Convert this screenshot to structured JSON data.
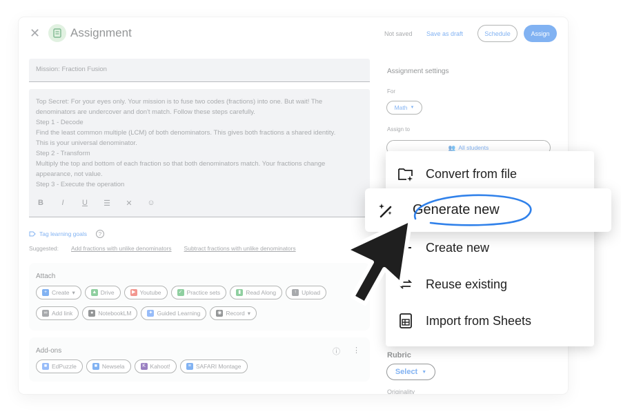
{
  "header": {
    "title": "Assignment",
    "status": "Not saved",
    "save_draft": "Save as draft",
    "schedule": "Schedule",
    "assign": "Assign"
  },
  "form": {
    "title_value": "Mission: Fraction Fusion",
    "instructions": [
      "Top Secret: For your eyes only. Your mission is to fuse two codes (fractions) into one. But wait! The",
      "denominators are undercover and don't match. Follow these steps carefully.",
      "Step 1 - Decode",
      "Find the least common multiple (LCM) of both denominators. This gives both fractions a shared identity.",
      "This is your universal denominator.",
      "Step 2 - Transform",
      "Multiply the top and bottom of each fraction so that both denominators match. Your fractions change",
      "appearance, not value.",
      "Step 3 - Execute the operation"
    ],
    "formatting": [
      "B",
      "I",
      "U",
      "☰",
      "✕",
      "☺"
    ]
  },
  "tags": {
    "link": "Tag learning goals",
    "suggested_label": "Suggested:",
    "suggestions": [
      "Add fractions with unlike denominators",
      "Subtract fractions with unlike denominators"
    ]
  },
  "attach": {
    "label": "Attach",
    "row1": [
      {
        "label": "Create",
        "icon": "+",
        "caret": true,
        "color": "#1a73e8"
      },
      {
        "label": "Drive",
        "icon": "▲",
        "color": "#34a853"
      },
      {
        "label": "Youtube",
        "icon": "▶",
        "color": "#ea4335"
      },
      {
        "label": "Practice sets",
        "icon": "✓",
        "color": "#34a853"
      },
      {
        "label": "Read Along",
        "icon": "▮",
        "color": "#34a853"
      },
      {
        "label": "Upload",
        "icon": "↑",
        "color": "#5f6368"
      }
    ],
    "row2": [
      {
        "label": "Add link",
        "icon": "∞",
        "color": "#5f6368"
      },
      {
        "label": "NotebookLM",
        "icon": "●",
        "color": "#3c4043"
      },
      {
        "label": "Guided Learning",
        "icon": "✦",
        "color": "#4285f4"
      },
      {
        "label": "Record",
        "icon": "◉",
        "caret": true,
        "color": "#3c4043"
      }
    ]
  },
  "addons": {
    "label": "Add-ons",
    "items": [
      {
        "label": "EdPuzzle",
        "icon": "■",
        "color": "#4285f4"
      },
      {
        "label": "Newsela",
        "icon": "■",
        "color": "#1a73e8"
      },
      {
        "label": "Kahoot!",
        "icon": "K",
        "color": "#46178f"
      },
      {
        "label": "SAFARI Montage",
        "icon": "≡",
        "color": "#1a73e8"
      }
    ]
  },
  "settings": {
    "title": "Assignment settings",
    "for_label": "For",
    "subject": "Math",
    "assign_to_label": "Assign to",
    "students": "All students",
    "rubric_label": "Rubric",
    "rubric_select": "Select",
    "originality": "Originality"
  },
  "menu": {
    "items": [
      {
        "label": "Convert from file",
        "icon": "folder-sparkle-icon"
      },
      {
        "label": "Create new",
        "icon": "plus-icon"
      },
      {
        "label": "Reuse existing",
        "icon": "repeat-icon"
      },
      {
        "label": "Import from Sheets",
        "icon": "sheets-icon"
      }
    ],
    "highlight": {
      "label": "Generate new",
      "icon": "magic-wand-icon"
    }
  },
  "colors": {
    "accent": "#1a73e8",
    "field_bg": "#e8eaed"
  }
}
